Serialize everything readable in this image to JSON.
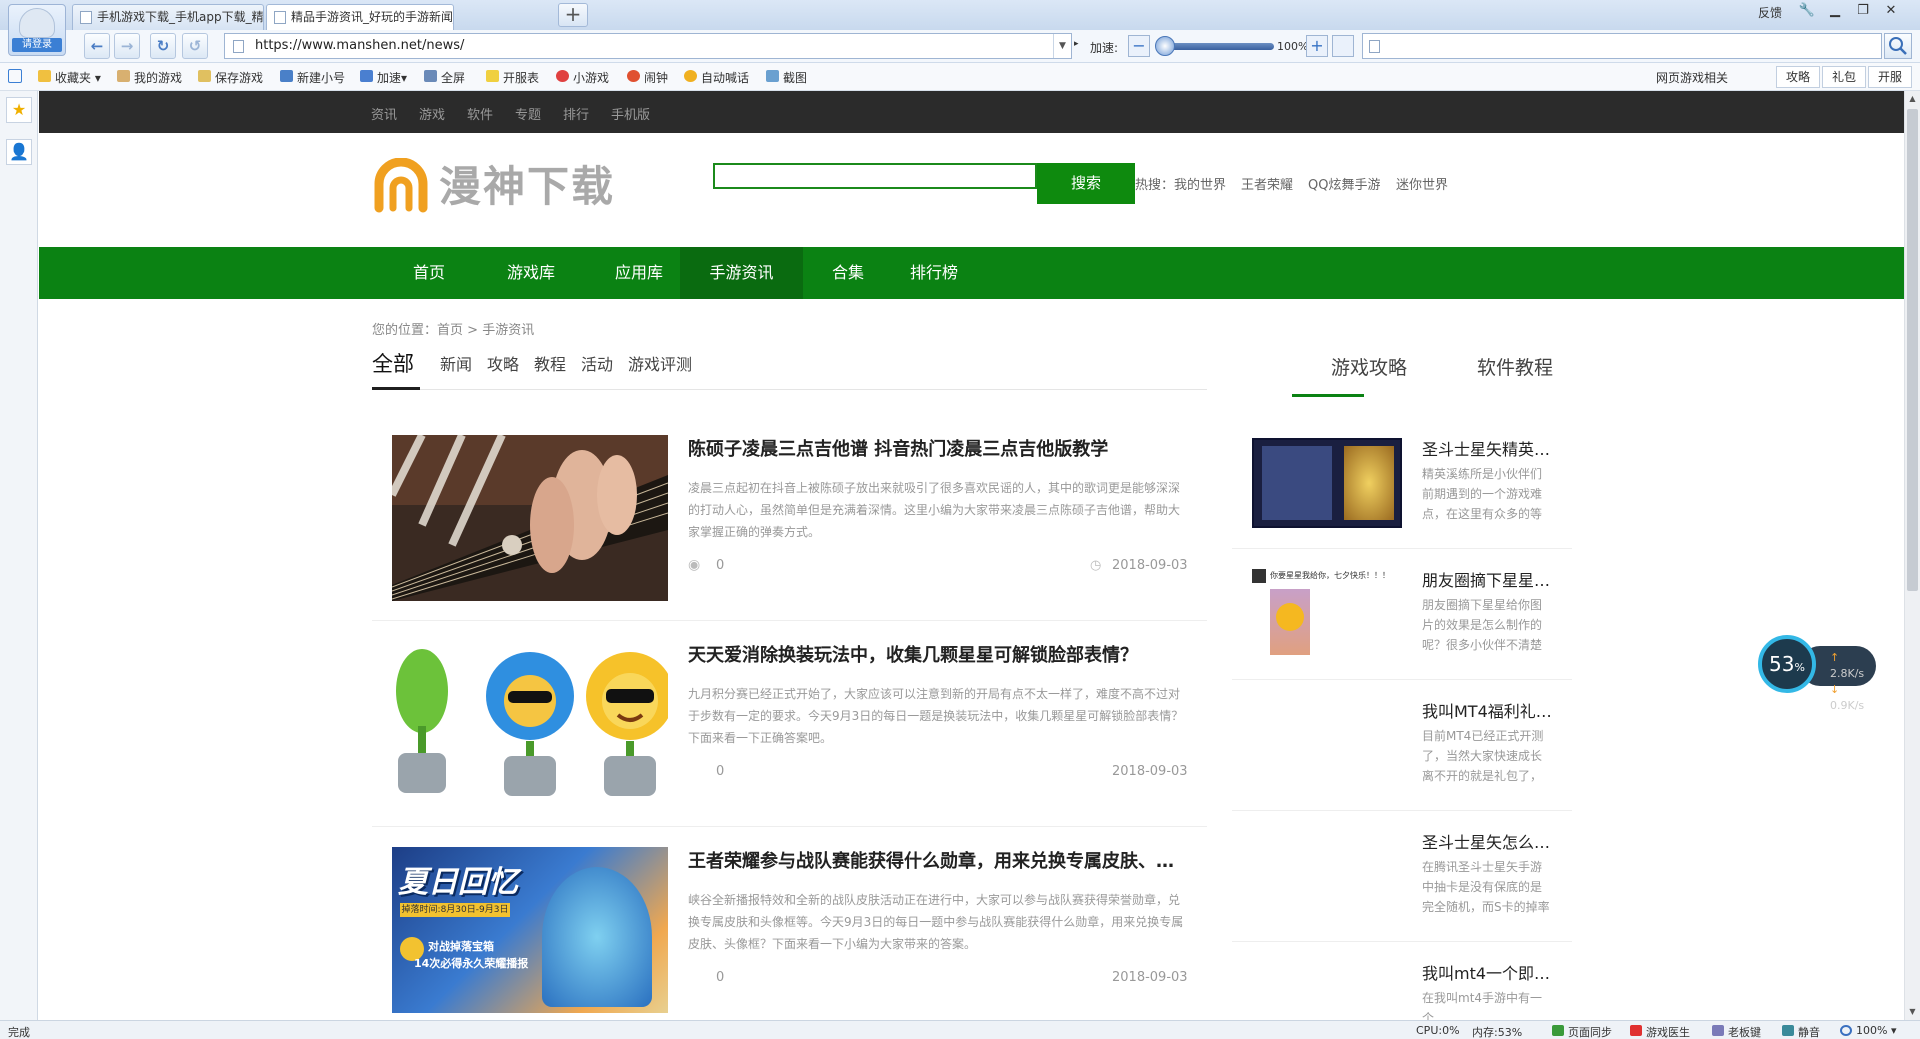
{
  "browser": {
    "login_label": "请登录",
    "tabs": [
      {
        "title": "手机游戏下载_手机app下载_精…",
        "active": false
      },
      {
        "title": "精品手游资讯_好玩的手游新闻_…",
        "active": true
      }
    ],
    "window_controls": {
      "feedback": "反馈"
    },
    "url": "https://www.manshen.net/news/",
    "speed_label": "加速:",
    "speed_value": "100%",
    "search_placeholder": ""
  },
  "bookmarks": {
    "items": [
      "收藏夹",
      "我的游戏",
      "保存游戏",
      "新建小号",
      "加速",
      "全屏",
      "开服表",
      "小游戏",
      "闹钟",
      "自动喊话",
      "截图"
    ],
    "right_label": "网页游戏相关",
    "right_buttons": [
      "攻略",
      "礼包",
      "开服"
    ]
  },
  "site": {
    "topnav": [
      "资讯",
      "游戏",
      "软件",
      "专题",
      "排行",
      "手机版"
    ],
    "logo_text": "漫神下载",
    "search_button": "搜索",
    "hot_label": "热搜：",
    "hot_terms": [
      "我的世界",
      "王者荣耀",
      "QQ炫舞手游",
      "迷你世界"
    ],
    "mainnav": [
      "首页",
      "游戏库",
      "应用库",
      "手游资讯",
      "合集",
      "排行榜"
    ],
    "mainnav_active": "手游资讯",
    "breadcrumb": {
      "prefix": "您的位置：",
      "home": "首页",
      "sep": ">",
      "current": "手游资讯"
    },
    "filters": [
      "全部",
      "新闻",
      "攻略",
      "教程",
      "活动",
      "游戏评测"
    ],
    "filter_active": "全部",
    "articles": [
      {
        "title": "陈硕子凌晨三点吉他谱 抖音热门凌晨三点吉他版教学",
        "desc": "凌晨三点起初在抖音上被陈硕子放出来就吸引了很多喜欢民谣的人，其中的歌词更是能够深深的打动人心，虽然简单但是充满着深情。这里小编为大家带来凌晨三点陈硕子吉他谱，帮助大家掌握正确的弹奏方式。",
        "views": "0",
        "date": "2018-09-03"
      },
      {
        "title": "天天爱消除换装玩法中，收集几颗星星可解锁脸部表情？",
        "desc": "九月积分赛已经正式开始了，大家应该可以注意到新的开局有点不太一样了，难度不高不过对于步数有一定的要求。今天9月3日的每日一题是换装玩法中，收集几颗星星可解锁脸部表情？下面来看一下正确答案吧。",
        "views": "0",
        "date": "2018-09-03"
      },
      {
        "title": "王者荣耀参与战队赛能获得什么勋章，用来兑换专属皮肤、…",
        "desc": "峡谷全新播报特效和全新的战队皮肤活动正在进行中，大家可以参与战队赛获得荣誉勋章，兑换专属皮肤和头像框等。今天9月3日的每日一题中参与战队赛能获得什么勋章，用来兑换专属皮肤、头像框？下面来看一下小编为大家带来的答案。",
        "views": "0",
        "date": "2018-09-03"
      }
    ],
    "article3_img_text": {
      "title": "夏日回忆",
      "sub": "掉落时间:8月30日-9月3日",
      "line1": "对战掉落宝箱",
      "line2": "14次必得永久荣耀播报"
    },
    "side_tabs": [
      "游戏攻略",
      "软件教程"
    ],
    "side_items": [
      {
        "title": "圣斗士星矢精英…",
        "desc": "精英溪练所是小伙伴们前期遇到的一个游戏难点，在这里有众多的等"
      },
      {
        "title": "朋友圈摘下星星…",
        "desc": "朋友圈摘下星星给你图片的效果是怎么制作的呢？很多小伙伴不清楚"
      },
      {
        "title": "我叫MT4福利礼…",
        "desc": "目前MT4已经正式开测了，当然大家快速成长离不开的就是礼包了，"
      },
      {
        "title": "圣斗士星矢怎么…",
        "desc": "在腾讯圣斗士星矢手游中抽卡是没有保底的是完全随机，而S卡的掉率"
      },
      {
        "title": "我叫mt4一个即…",
        "desc": "在我叫mt4手游中有一个"
      }
    ],
    "side_item2_caption": "你要星星我给你，七夕快乐！！！"
  },
  "net_widget": {
    "percent": "53",
    "percent_unit": "%",
    "up": "2.8K/s",
    "down": "0.9K/s"
  },
  "status": {
    "left": "完成",
    "cpu": "CPU:0%",
    "mem": "内存:53%",
    "items": [
      "页面同步",
      "游戏医生",
      "老板键",
      "静音",
      "100%"
    ]
  },
  "colors": {
    "brand_green": "#0b8213",
    "topnav_bg": "#2b2b2b",
    "logo_orange": "#f0a020"
  }
}
